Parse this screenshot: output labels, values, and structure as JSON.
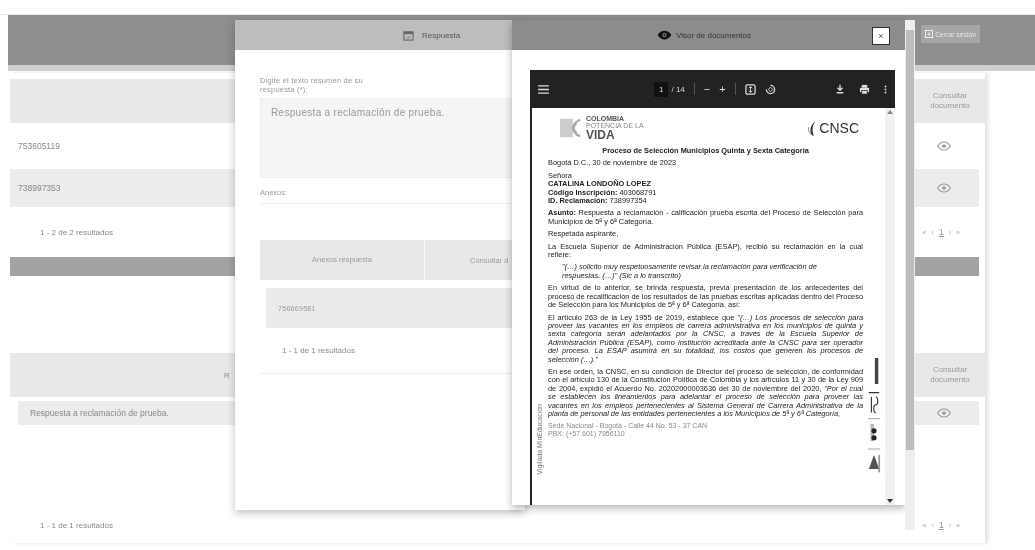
{
  "header": {
    "logout_button": "Cerrar sesión"
  },
  "claims_table": {
    "columns": [
      {
        "label": "Consultar documento"
      }
    ],
    "rows": [
      {
        "id": "753605119",
        "shaded": false
      },
      {
        "id": "738997353",
        "shaded": true
      }
    ],
    "summary": "1 - 2 de 2 resultados",
    "pager": [
      "«",
      "‹",
      "1",
      "›",
      "»"
    ]
  },
  "responses_table": {
    "columns": [
      {
        "label": "R"
      },
      {
        "label": "Consultar documento"
      }
    ],
    "rows": [
      {
        "text": "Respuesta a reclamación de prueba.",
        "shaded": true
      }
    ],
    "summary": "1 - 1 de 1 resultados",
    "pager": [
      "«",
      "‹",
      "1",
      "›",
      "»"
    ]
  },
  "response_modal": {
    "title": "Respuesta",
    "summary_label": "Digite el texto resumen de su respuesta (*):",
    "summary_value": "Respuesta a reclamación de prueba.",
    "attachments_label": "Anexos:",
    "attachments_table": {
      "columns": [
        "Anexos respuesta",
        "Consultar d"
      ],
      "rows": [
        "756669581"
      ],
      "summary": "1 - 1 de 1 resultados"
    }
  },
  "viewer_modal": {
    "title": "Visor de documentos",
    "close": "×",
    "toolbar": {
      "page": "1",
      "page_count": "/ 14",
      "zoom_out": "−",
      "zoom_in": "+"
    },
    "document": {
      "logo_left": [
        "COLOMBIA",
        "POTENCIA DE LA",
        "VIDA"
      ],
      "logo_right": "CNSC",
      "heading": "Proceso de Selección Municipios Quinta y Sexta Categoría",
      "blocks": [
        {
          "kind": "para",
          "text": "Bogotá D.C., 30 de noviembre de 2023"
        },
        {
          "kind": "lines",
          "lines": [
            {
              "kind": "plain",
              "text": "Señora"
            },
            {
              "kind": "name",
              "text": "CATALINA LONDOÑO LOPEZ"
            },
            {
              "kind": "plain",
              "text": "**Código Inscripción:** 403068791"
            },
            {
              "kind": "plain",
              "text": "**ID. Reclamación:** 738997354"
            }
          ]
        },
        {
          "kind": "para",
          "text": "**Asunto:** Respuesta a reclamación - calificación prueba escrita del Proceso de Selección para Municipios de 5ª y 6ª Categoría."
        },
        {
          "kind": "para",
          "text": "Respetada aspirante,"
        },
        {
          "kind": "para",
          "text": "La Escuela Superior de Administración Pública (ESAP), recibió su reclamación en la cual refiere:"
        },
        {
          "kind": "quote",
          "text": "\"(…) solicito muy respetuosamente revisar la reclamación para verificación de respuestas. (…)\" (Sic a lo transcrito)"
        },
        {
          "kind": "para",
          "text": "En virtud de lo anterior, se brinda respuesta, previa presentación de los antecedentes del proceso de recalificación de los resultados de las pruebas escritas aplicadas dentro del Proceso de Selección para los Municipios de 5ª y 6ª Categoría, así:"
        },
        {
          "kind": "para",
          "text": "El artículo 263 de la Ley 1955 de 2019, establece que *\"(…) Los procesos de selección para proveer las vacantes en los empleos de carrera administrativa en los municipios de quinta y sexta categoría serán adelantados por la CNSC, a través de la Escuela Superior de Administración Pública (ESAP), como institución acreditada ante la CNSC para ser operador del proceso. La ESAP asumirá en su totalidad, los costos que generen los procesos de selección (…).\"*"
        },
        {
          "kind": "para",
          "text": "En ese orden, la CNSC, en su condición de Director del proceso de selección, de conformidad con el artículo 130 de la Constitución Política de Colombia y los artículos 11 y 30 de la Ley 909 de 2004, expidió el Acuerdo No. 20202000003636 del 30 de noviembre del 2020, *\"Por el cual se establecen los lineamientos para adelantar el proceso de selección para proveer las vacantes en los empleos pertenecientes al Sistema General de Carrera Administrativa de la planta de personal de las entidades pertenecientes a los Municipios de 5ª y 6ª Categoría,*"
        }
      ],
      "margin_note": "Vigilada MinEducación",
      "footer": [
        "Sede Nacional - Bogotá - Calle 44 No. 53 - 37 CAN",
        "PBX: (+57 601) 7956110"
      ]
    }
  }
}
